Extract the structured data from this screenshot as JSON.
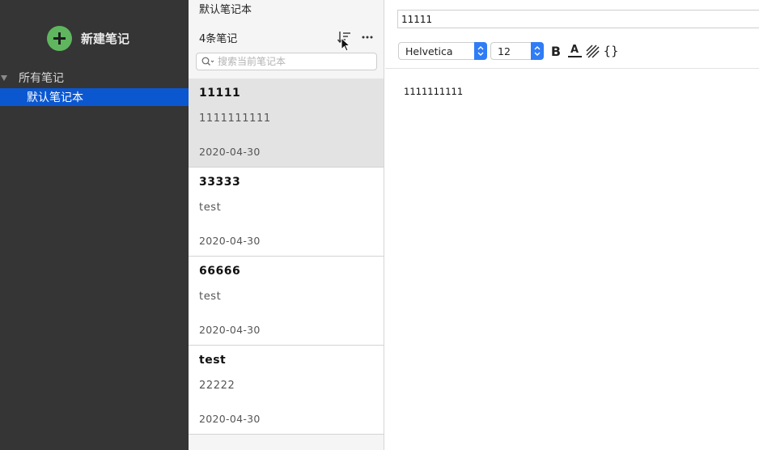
{
  "sidebar": {
    "new_note_label": "新建笔记",
    "tree": {
      "all_notes_label": "所有笔记",
      "default_notebook_label": "默认笔记本"
    }
  },
  "note_list": {
    "notebook_title": "默认笔记本",
    "count_label": "4条笔记",
    "search_placeholder": "搜索当前笔记本",
    "notes": [
      {
        "title": "11111",
        "preview": "1111111111",
        "date": "2020-04-30",
        "selected": true
      },
      {
        "title": "33333",
        "preview": "test",
        "date": "2020-04-30",
        "selected": false
      },
      {
        "title": "66666",
        "preview": "test",
        "date": "2020-04-30",
        "selected": false
      },
      {
        "title": "test",
        "preview": "22222",
        "date": "2020-04-30",
        "selected": false
      }
    ]
  },
  "editor": {
    "title_value": "11111",
    "toolbar": {
      "font_family": "Helvetica",
      "font_size": "12",
      "bold_label": "B",
      "color_label": "A",
      "code_label": "{}"
    },
    "content": "1111111111"
  },
  "colors": {
    "sidebar_bg": "#353535",
    "selection_blue": "#0b57d0",
    "new_note_green": "#5fb65f",
    "stepper_blue": "#2f7cf6"
  }
}
